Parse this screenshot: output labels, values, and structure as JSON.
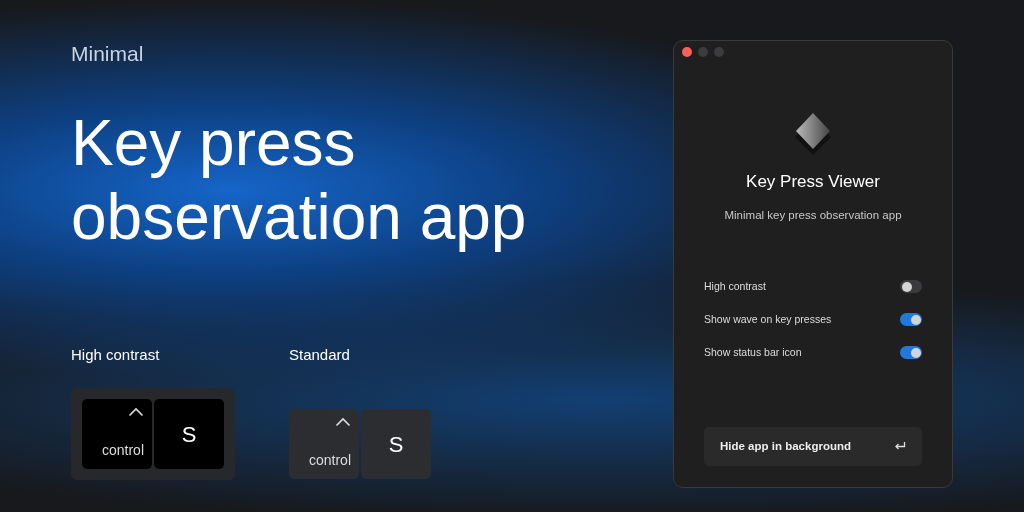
{
  "eyebrow": "Minimal",
  "headline": "Key press observation app",
  "previews": [
    {
      "title": "High contrast",
      "kind": "high_contrast",
      "keys": [
        {
          "kind": "modifier",
          "label": "control"
        },
        {
          "kind": "letter",
          "label": "S"
        }
      ]
    },
    {
      "title": "Standard",
      "kind": "standard",
      "keys": [
        {
          "kind": "modifier",
          "label": "control"
        },
        {
          "kind": "letter",
          "label": "S"
        }
      ]
    }
  ],
  "window": {
    "title": "Key Press Viewer",
    "subtitle": "Minimal key press observation app",
    "settings": [
      {
        "label": "High contrast",
        "on": false
      },
      {
        "label": "Show wave on key presses",
        "on": true
      },
      {
        "label": "Show status bar icon",
        "on": true
      }
    ],
    "button": {
      "label": "Hide app in background"
    }
  }
}
